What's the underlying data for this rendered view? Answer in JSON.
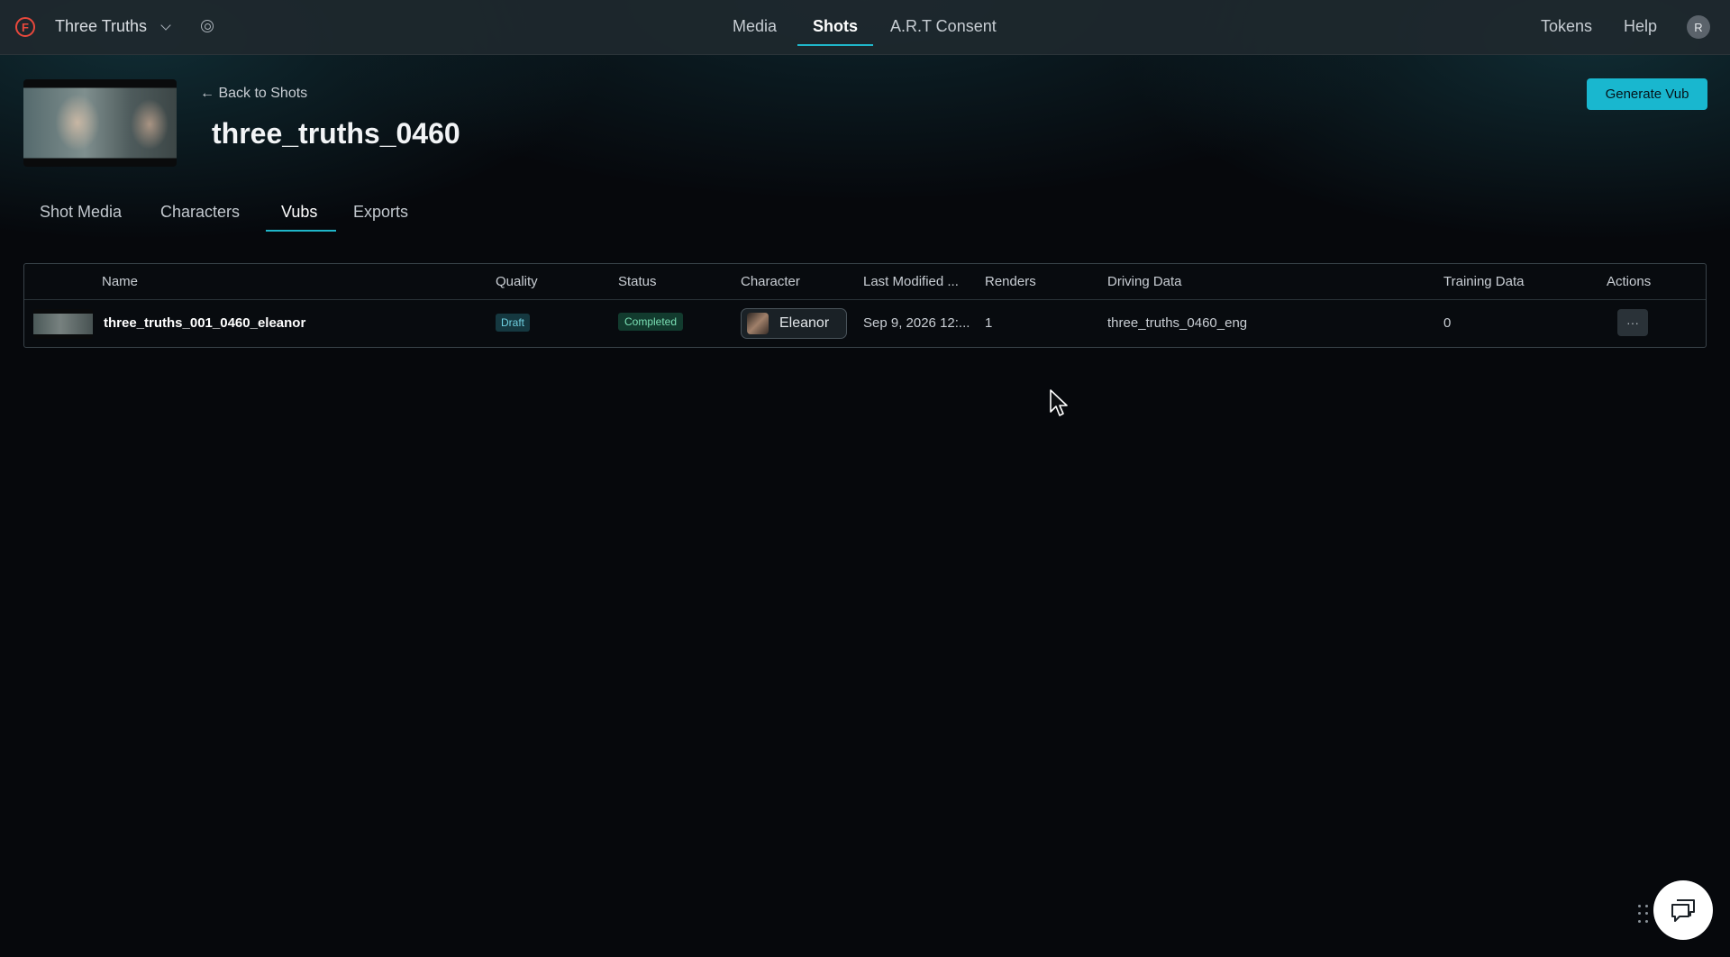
{
  "topbar": {
    "logo_letter": "F",
    "project_name": "Three Truths",
    "nav": [
      "Media",
      "Shots",
      "A.R.T Consent"
    ],
    "active_nav": "Shots",
    "tokens_label": "Tokens",
    "help_label": "Help",
    "avatar_initial": "R"
  },
  "header": {
    "back_label": "← Back to Shots",
    "title": "three_truths_0460",
    "generate_label": "Generate Vub"
  },
  "tabs": {
    "items": [
      "Shot Media",
      "Characters",
      "Vubs",
      "Exports"
    ],
    "active": "Vubs"
  },
  "table": {
    "columns": [
      "Name",
      "Quality",
      "Status",
      "Character",
      "Last Modified ...",
      "Renders",
      "Driving Data",
      "Training Data",
      "Actions"
    ],
    "rows": [
      {
        "name": "three_truths_001_0460_eleanor",
        "quality": "Draft",
        "status": "Completed",
        "character": "Eleanor",
        "last_modified": "Sep 9, 2026 12:...",
        "renders": "1",
        "driving_data": "three_truths_0460_eng",
        "training_data": "0",
        "actions": "···"
      }
    ]
  },
  "colors": {
    "accent": "#19b7cf",
    "logo": "#e8483c",
    "background": "#06080c"
  }
}
